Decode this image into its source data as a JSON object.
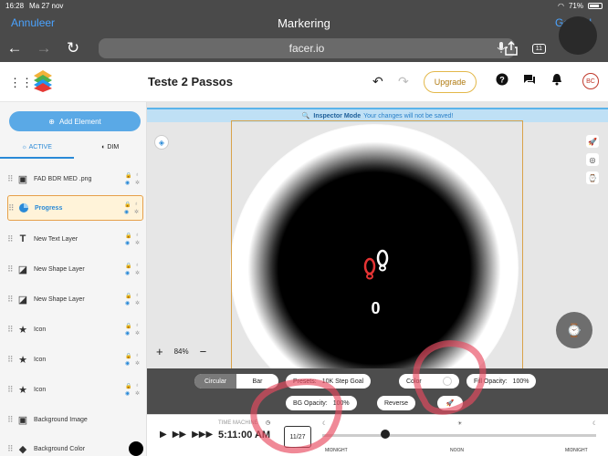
{
  "status_bar": {
    "time": "16:28",
    "date": "Ma 27 nov",
    "battery": "71%"
  },
  "browser": {
    "cancel_label": "Annuleer",
    "title": "Markering",
    "done_label": "Gereed",
    "url": "facer.io",
    "tab_count": "11"
  },
  "app": {
    "document_title": "Teste 2 Passos",
    "upgrade_label": "Upgrade",
    "avatar_initials": "BC"
  },
  "sidebar": {
    "add_element_label": "Add Element",
    "tabs": [
      {
        "label": "ACTIVE"
      },
      {
        "label": "DIM"
      }
    ],
    "layers": [
      {
        "label": "FAD BDR MED .png",
        "icon": "image-icon"
      },
      {
        "label": "Progress",
        "icon": "progress-icon"
      },
      {
        "label": "New Text Layer",
        "icon": "text-icon"
      },
      {
        "label": "New Shape Layer",
        "icon": "shape-icon"
      },
      {
        "label": "New Shape Layer",
        "icon": "shape-icon"
      },
      {
        "label": "Icon",
        "icon": "star-icon"
      },
      {
        "label": "Icon",
        "icon": "star-icon"
      },
      {
        "label": "Icon",
        "icon": "star-icon"
      },
      {
        "label": "Background Image",
        "icon": "image-icon"
      },
      {
        "label": "Background Color",
        "icon": "paint-icon"
      }
    ]
  },
  "editor": {
    "inspector_title": "Inspector Mode",
    "inspector_note": "Your changes will not be saved!",
    "zoom_level": "84%",
    "face_value": "0"
  },
  "properties": {
    "mode_options": [
      "Circular",
      "Bar"
    ],
    "mode_selected": "Circular",
    "presets_label": "Presets:",
    "presets_value": "10K Step Goal",
    "color_label": "Color",
    "fill_opacity_label": "Fill Opacity:",
    "fill_opacity_value": "100%",
    "bg_opacity_label": "BG Opacity:",
    "bg_opacity_value": "100%",
    "reverse_label": "Reverse"
  },
  "timeline": {
    "label": "TIME MACHINE",
    "time": "5:11:00 AM",
    "date": "11/27",
    "midnight_start": "MIDNIGHT",
    "noon": "NOON",
    "midnight_end": "MIDNIGHT"
  },
  "colors": {
    "accent": "#2a8ad7",
    "selection": "#e6a04a",
    "upgrade": "#e3b84a",
    "annotation": "#e84a5f"
  }
}
